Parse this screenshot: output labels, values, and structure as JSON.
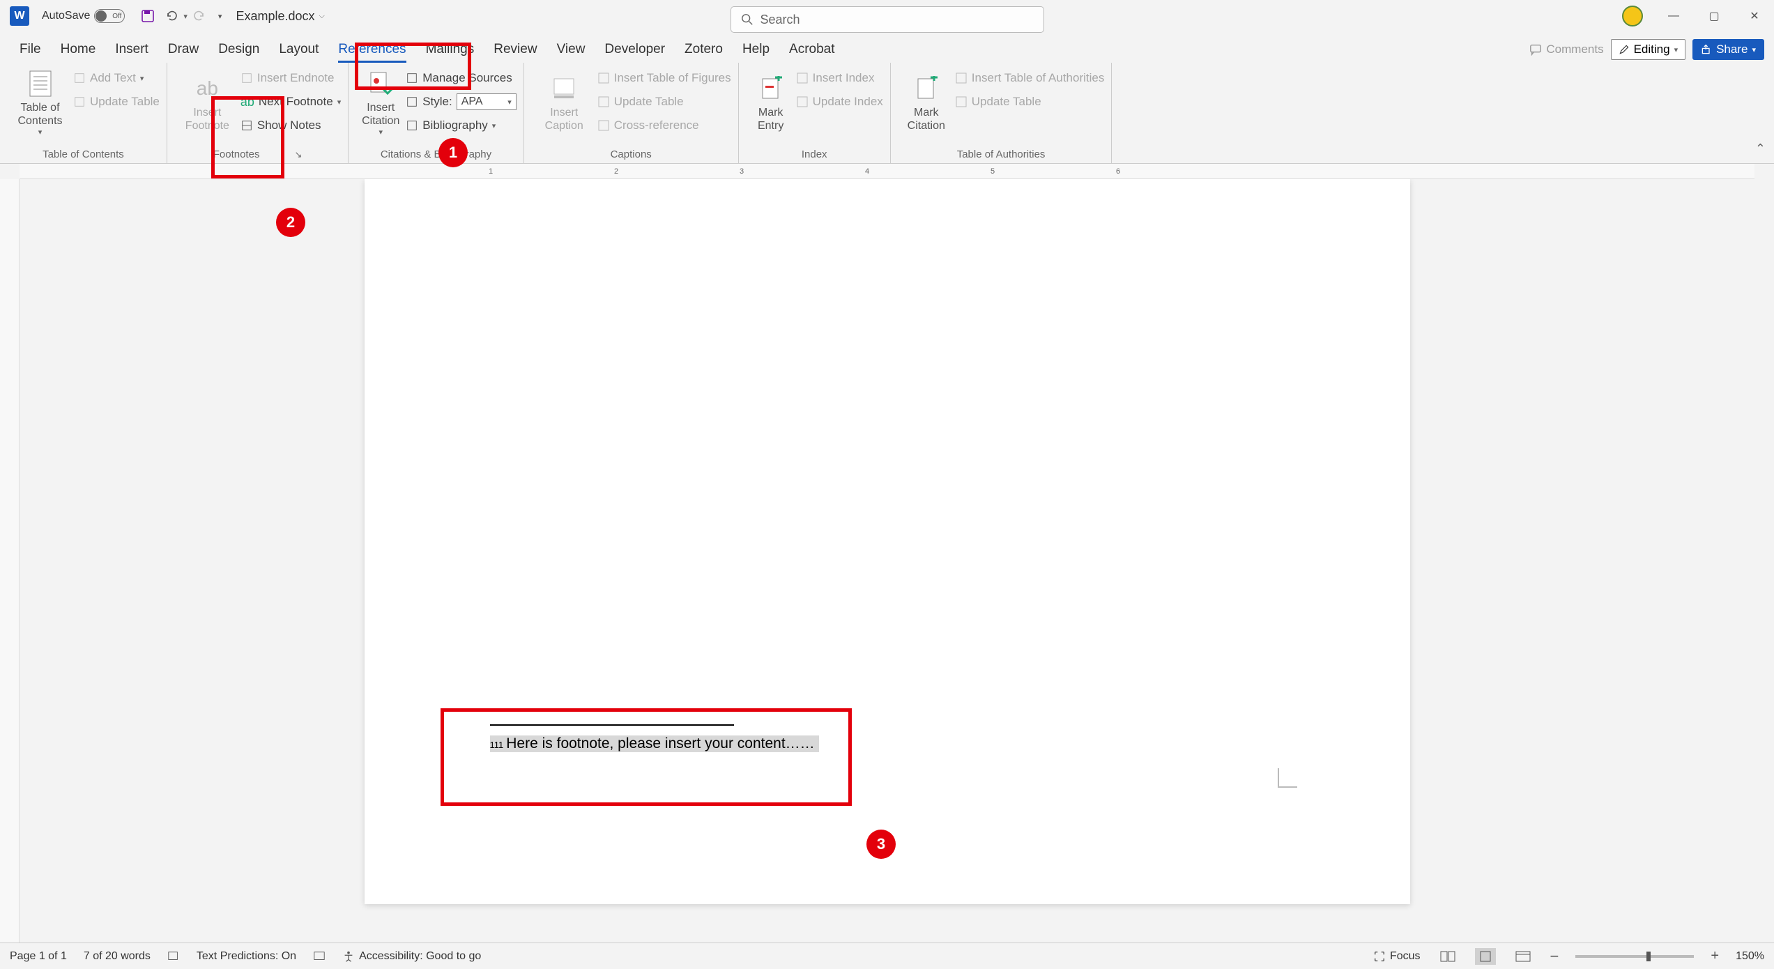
{
  "titlebar": {
    "autosave_label": "AutoSave",
    "autosave_state": "Off",
    "doc_name": "Example.docx",
    "search_placeholder": "Search"
  },
  "window_buttons": {
    "min": "—",
    "max": "▢",
    "close": "✕"
  },
  "tabs": {
    "file": "File",
    "home": "Home",
    "insert": "Insert",
    "draw": "Draw",
    "design": "Design",
    "layout": "Layout",
    "references": "References",
    "mailings": "Mailings",
    "review": "Review",
    "view": "View",
    "developer": "Developer",
    "zotero": "Zotero",
    "help": "Help",
    "acrobat": "Acrobat"
  },
  "tabs_right": {
    "comments": "Comments",
    "editing": "Editing",
    "share": "Share"
  },
  "ribbon": {
    "toc": {
      "big": "Table of\nContents",
      "add_text": "Add Text",
      "update": "Update Table",
      "group": "Table of Contents"
    },
    "footnotes": {
      "insert": "Insert\nFootnote",
      "insert_endnote": "Insert Endnote",
      "next_footnote": "Next Footnote",
      "show_notes": "Show Notes",
      "group": "Footnotes"
    },
    "research": {
      "big": "Insert\nCitation"
    },
    "citations": {
      "manage": "Manage Sources",
      "style_label": "Style:",
      "style_value": "APA",
      "bibliography": "Bibliography",
      "group": "Citations & Bibliography"
    },
    "captions": {
      "big": "Insert\nCaption",
      "tof": "Insert Table of Figures",
      "update": "Update Table",
      "cross": "Cross-reference",
      "group": "Captions"
    },
    "index": {
      "big": "Mark\nEntry",
      "insert": "Insert Index",
      "update": "Update Index",
      "group": "Index"
    },
    "authorities": {
      "big": "Mark\nCitation",
      "insert": "Insert Table of Authorities",
      "update": "Update Table",
      "group": "Table of Authorities"
    }
  },
  "hruler_ticks": [
    "1",
    "2",
    "3",
    "4",
    "5",
    "6"
  ],
  "document": {
    "footnote_marker": "111",
    "footnote_text": "Here is footnote, please insert your content……"
  },
  "annotations": {
    "n1": "1",
    "n2": "2",
    "n3": "3"
  },
  "status": {
    "page": "Page 1 of 1",
    "words": "7 of 20 words",
    "predictions": "Text Predictions: On",
    "accessibility": "Accessibility: Good to go",
    "focus": "Focus",
    "zoom": "150%"
  }
}
